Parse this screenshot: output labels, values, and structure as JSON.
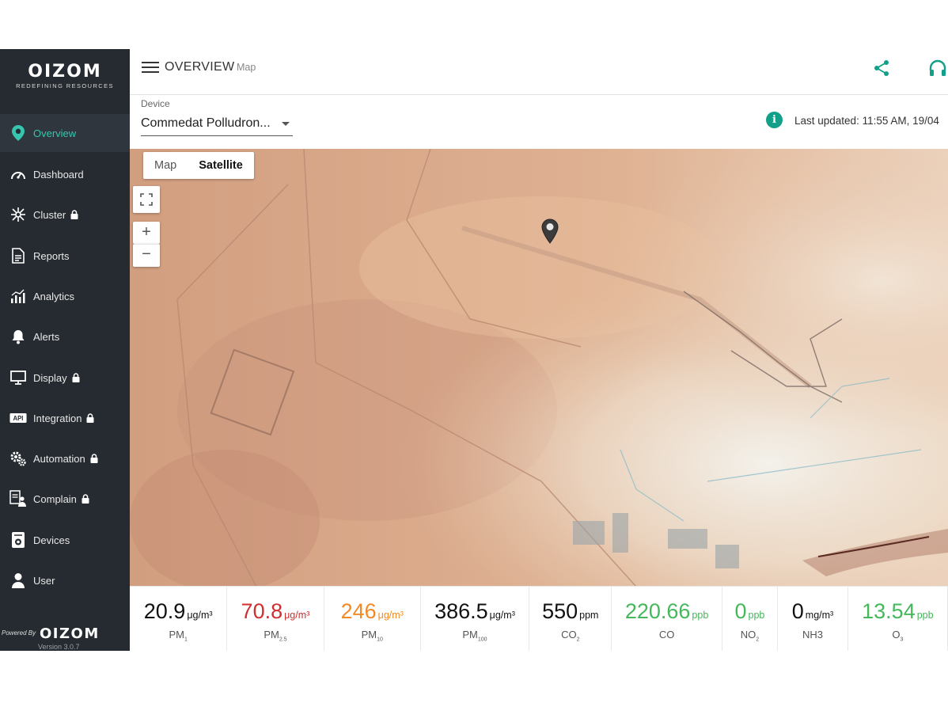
{
  "brand": {
    "name": "OIZOM",
    "tagline": "REDEFINING RESOURCES",
    "powered_by": "Powered By",
    "version": "Version 3.0.7"
  },
  "sidebar": {
    "items": [
      {
        "label": "Overview",
        "icon": "location-pin-icon",
        "active": true,
        "locked": false
      },
      {
        "label": "Dashboard",
        "icon": "speedometer-icon",
        "active": false,
        "locked": false
      },
      {
        "label": "Cluster",
        "icon": "cluster-network-icon",
        "active": false,
        "locked": true
      },
      {
        "label": "Reports",
        "icon": "report-document-icon",
        "active": false,
        "locked": false
      },
      {
        "label": "Analytics",
        "icon": "bar-chart-icon",
        "active": false,
        "locked": false
      },
      {
        "label": "Alerts",
        "icon": "bell-icon",
        "active": false,
        "locked": false
      },
      {
        "label": "Display",
        "icon": "monitor-icon",
        "active": false,
        "locked": true
      },
      {
        "label": "Integration",
        "icon": "api-icon",
        "active": false,
        "locked": true
      },
      {
        "label": "Automation",
        "icon": "gears-icon",
        "active": false,
        "locked": true
      },
      {
        "label": "Complain",
        "icon": "complaint-form-icon",
        "active": false,
        "locked": true
      },
      {
        "label": "Devices",
        "icon": "device-icon",
        "active": false,
        "locked": false
      },
      {
        "label": "User",
        "icon": "user-icon",
        "active": false,
        "locked": false
      }
    ]
  },
  "header": {
    "title": "OVERVIEW",
    "subtitle": "Map"
  },
  "device": {
    "label": "Device",
    "selected": "Commedat Polludron...",
    "last_updated": "Last updated: 11:55 AM, 19/04"
  },
  "map": {
    "types": [
      "Map",
      "Satellite"
    ],
    "selected_type": "Satellite",
    "zoom_in": "+",
    "zoom_out": "−"
  },
  "readings": [
    {
      "value": "20.9",
      "unit": "μg/m³",
      "param": "PM",
      "sub": "1",
      "color": "#111111"
    },
    {
      "value": "70.8",
      "unit": "μg/m³",
      "param": "PM",
      "sub": "2.5",
      "color": "#cf2f2f"
    },
    {
      "value": "246",
      "unit": "μg/m³",
      "param": "PM",
      "sub": "10",
      "color": "#f08b26"
    },
    {
      "value": "386.5",
      "unit": "μg/m³",
      "param": "PM",
      "sub": "100",
      "color": "#111111"
    },
    {
      "value": "550",
      "unit": "ppm",
      "param": "CO",
      "sub": "2",
      "color": "#111111"
    },
    {
      "value": "220.66",
      "unit": "ppb",
      "param": "CO",
      "sub": "",
      "color": "#44b85a"
    },
    {
      "value": "0",
      "unit": "ppb",
      "param": "NO",
      "sub": "2",
      "color": "#44b85a"
    },
    {
      "value": "0",
      "unit": "mg/m³",
      "param": "NH3",
      "sub": "",
      "color": "#111111"
    },
    {
      "value": "13.54",
      "unit": "ppb",
      "param": "O",
      "sub": "3",
      "color": "#44b85a"
    }
  ],
  "colors": {
    "sidebar_bg": "#262b31",
    "accent": "#37c5b0",
    "info": "#12a08a"
  }
}
